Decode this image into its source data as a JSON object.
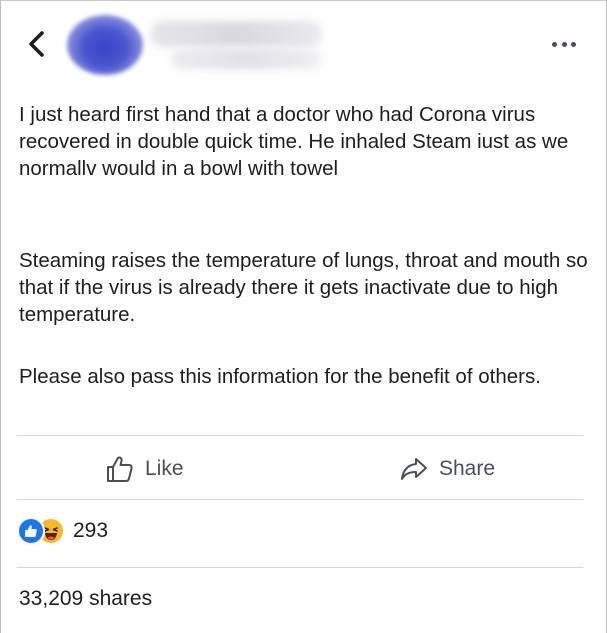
{
  "header": {
    "back_icon": "chevron-left-icon",
    "more_icon": "ellipsis-horizontal-icon",
    "avatar_color": "#3a44c8"
  },
  "post": {
    "paragraph_1": "I just heard first hand that a doctor who had Corona virus recovered in double quick time. He inhaled Steam iust as we normallv would in a bowl with towel",
    "paragraph_2": "Steaming raises the temperature of lungs, throat and mouth so that if the virus is already there it gets inactivate due to high temperature.",
    "paragraph_3": "Please also pass this information for the benefit of others."
  },
  "actions": {
    "like_label": "Like",
    "like_icon": "thumbs-up-icon",
    "share_label": "Share",
    "share_icon": "share-arrow-icon"
  },
  "reactions": {
    "icons": [
      "like-reaction-icon",
      "haha-reaction-icon"
    ],
    "count": "293",
    "like_color": "#1877f2",
    "haha_color": "#f7b928"
  },
  "shares": {
    "label": "33,209 shares"
  }
}
